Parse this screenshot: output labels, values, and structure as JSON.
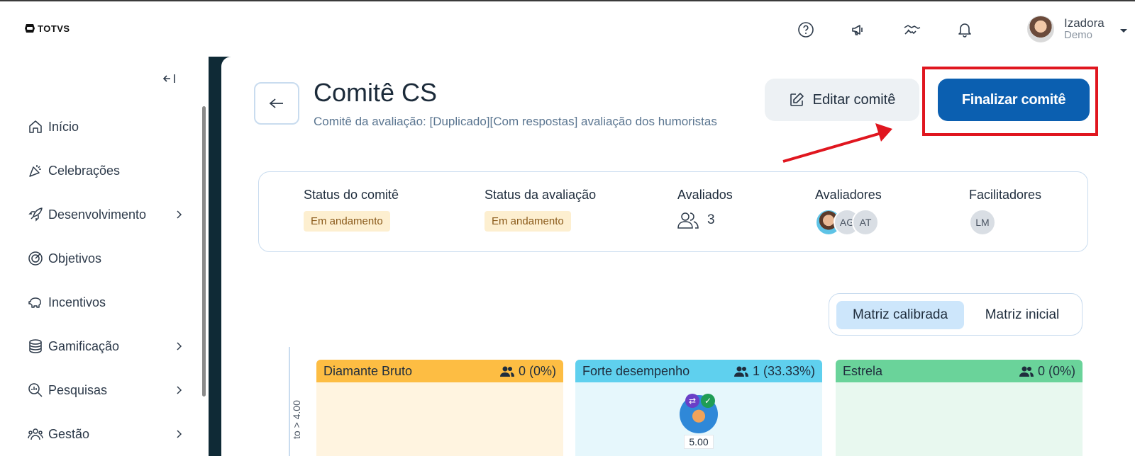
{
  "app": {
    "logo": "TOTVS"
  },
  "header": {
    "icons": [
      "help-icon",
      "megaphone-icon",
      "handshake-icon",
      "bell-icon"
    ],
    "user": {
      "name": "Izadora",
      "role": "Demo"
    }
  },
  "sidebar": {
    "items": [
      {
        "label": "Início",
        "icon": "home-icon",
        "has_children": false
      },
      {
        "label": "Celebrações",
        "icon": "party-icon",
        "has_children": false
      },
      {
        "label": "Desenvolvimento",
        "icon": "rocket-icon",
        "has_children": true
      },
      {
        "label": "Objetivos",
        "icon": "target-icon",
        "has_children": false
      },
      {
        "label": "Incentivos",
        "icon": "piggy-bank-icon",
        "has_children": false
      },
      {
        "label": "Gamificação",
        "icon": "coins-icon",
        "has_children": true
      },
      {
        "label": "Pesquisas",
        "icon": "search-chart-icon",
        "has_children": true
      },
      {
        "label": "Gestão",
        "icon": "people-icon",
        "has_children": true
      }
    ]
  },
  "page": {
    "title": "Comitê CS",
    "subtitle": "Comitê da avaliação: [Duplicado][Com respostas] avaliação dos humoristas",
    "edit_label": "Editar comitê",
    "finalize_label": "Finalizar comitê"
  },
  "status": {
    "committee_label": "Status do comitê",
    "committee_value": "Em andamento",
    "evaluation_label": "Status da avaliação",
    "evaluation_value": "Em andamento",
    "evaluated_label": "Avaliados",
    "evaluated_count": "3",
    "evaluators_label": "Avaliadores",
    "evaluators": [
      "",
      "AG",
      "AT"
    ],
    "facilitators_label": "Facilitadores",
    "facilitators": [
      "LM"
    ]
  },
  "matrix_toggle": {
    "calibrated": "Matriz calibrada",
    "initial": "Matriz inicial",
    "active": "calibrated"
  },
  "matrix": {
    "axis_label": "to > 4.00",
    "cells": [
      {
        "title": "Diamante Bruto",
        "count": "0 (0%)",
        "head_color": "#fdbd43",
        "body_color": "#fff4e0"
      },
      {
        "title": "Forte desempenho",
        "count": "1 (33.33%)",
        "head_color": "#5fd0ee",
        "body_color": "#e6f7fc"
      },
      {
        "title": "Estrela",
        "count": "0 (0%)",
        "head_color": "#6ad39a",
        "body_color": "#e8f8ef"
      }
    ],
    "person_score": "5.00"
  },
  "colors": {
    "primary": "#0b5fb0",
    "highlight": "#e0161f",
    "frame": "#0f2a36"
  }
}
